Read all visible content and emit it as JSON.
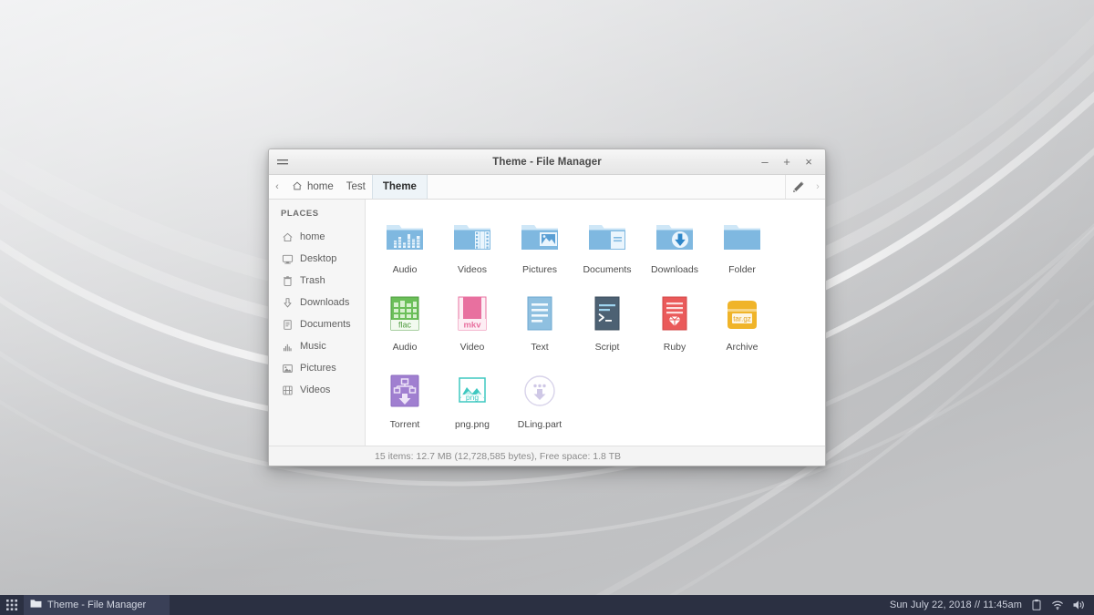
{
  "desktop": {
    "wallpaper_base": "#c9cacc",
    "wallpaper_name": "gray-ribbons-wallpaper"
  },
  "window": {
    "title": "Theme - File Manager",
    "menu_icon": "hamburger-icon",
    "controls": {
      "minimize": "–",
      "maximize": "+",
      "close": "×"
    }
  },
  "pathbar": {
    "back_arrow": "‹",
    "forward_arrow": "›",
    "edit_icon": "pencil-icon",
    "crumbs": [
      {
        "label": "home",
        "icon": "home-icon",
        "active": false
      },
      {
        "label": "Test",
        "icon": "",
        "active": false
      },
      {
        "label": "Theme",
        "icon": "",
        "active": true
      }
    ]
  },
  "sidebar": {
    "heading": "PLACES",
    "items": [
      {
        "label": "home",
        "icon": "home-icon"
      },
      {
        "label": "Desktop",
        "icon": "monitor-icon"
      },
      {
        "label": "Trash",
        "icon": "trash-icon"
      },
      {
        "label": "Downloads",
        "icon": "download-arrow-icon"
      },
      {
        "label": "Documents",
        "icon": "document-icon"
      },
      {
        "label": "Music",
        "icon": "music-icon"
      },
      {
        "label": "Pictures",
        "icon": "picture-icon"
      },
      {
        "label": "Videos",
        "icon": "video-icon"
      }
    ]
  },
  "files": [
    {
      "label": "Audio",
      "icon": "folder-audio-icon",
      "kind": "folder"
    },
    {
      "label": "Videos",
      "icon": "folder-videos-icon",
      "kind": "folder"
    },
    {
      "label": "Pictures",
      "icon": "folder-pictures-icon",
      "kind": "folder"
    },
    {
      "label": "Documents",
      "icon": "folder-documents-icon",
      "kind": "folder"
    },
    {
      "label": "Downloads",
      "icon": "folder-downloads-icon",
      "kind": "folder"
    },
    {
      "label": "Folder",
      "icon": "folder-plain-icon",
      "kind": "folder"
    },
    {
      "label": "Audio",
      "icon": "file-flac-icon",
      "kind": "file",
      "badge": "flac"
    },
    {
      "label": "Video",
      "icon": "file-mkv-icon",
      "kind": "file",
      "badge": "mkv"
    },
    {
      "label": "Text",
      "icon": "file-text-icon",
      "kind": "file"
    },
    {
      "label": "Script",
      "icon": "file-script-icon",
      "kind": "file"
    },
    {
      "label": "Ruby",
      "icon": "file-ruby-icon",
      "kind": "file"
    },
    {
      "label": "Archive",
      "icon": "file-archive-icon",
      "kind": "file",
      "badge": "tar.gz"
    },
    {
      "label": "Torrent",
      "icon": "file-torrent-icon",
      "kind": "file"
    },
    {
      "label": "png.png",
      "icon": "file-png-icon",
      "kind": "file",
      "badge": "png"
    },
    {
      "label": "DLing.part",
      "icon": "file-partial-icon",
      "kind": "file"
    }
  ],
  "statusbar": {
    "text": "15 items: 12.7 MB (12,728,585 bytes), Free space: 1.8 TB"
  },
  "taskbar": {
    "launcher_icon": "app-grid-icon",
    "task": {
      "label": "Theme - File Manager",
      "icon": "folder-icon"
    },
    "clock": "Sun July 22, 2018  //  11:45am",
    "tray": [
      {
        "icon": "clipboard-icon"
      },
      {
        "icon": "wifi-icon"
      },
      {
        "icon": "volume-icon"
      }
    ]
  },
  "colors": {
    "folder_blue": "#7fb8e0",
    "folder_blue_dark": "#5a9fd4",
    "flac_green": "#6bbf59",
    "mkv_pink": "#e8709f",
    "text_blue": "#8fc0e0",
    "script_slate": "#4d6173",
    "ruby_red": "#ea5a5a",
    "archive_yellow": "#f0b429",
    "torrent_purple": "#a07fd0",
    "png_teal": "#3ec8c0",
    "taskbar_bg": "#2b3042",
    "accent_tab": "#eef4f8"
  }
}
